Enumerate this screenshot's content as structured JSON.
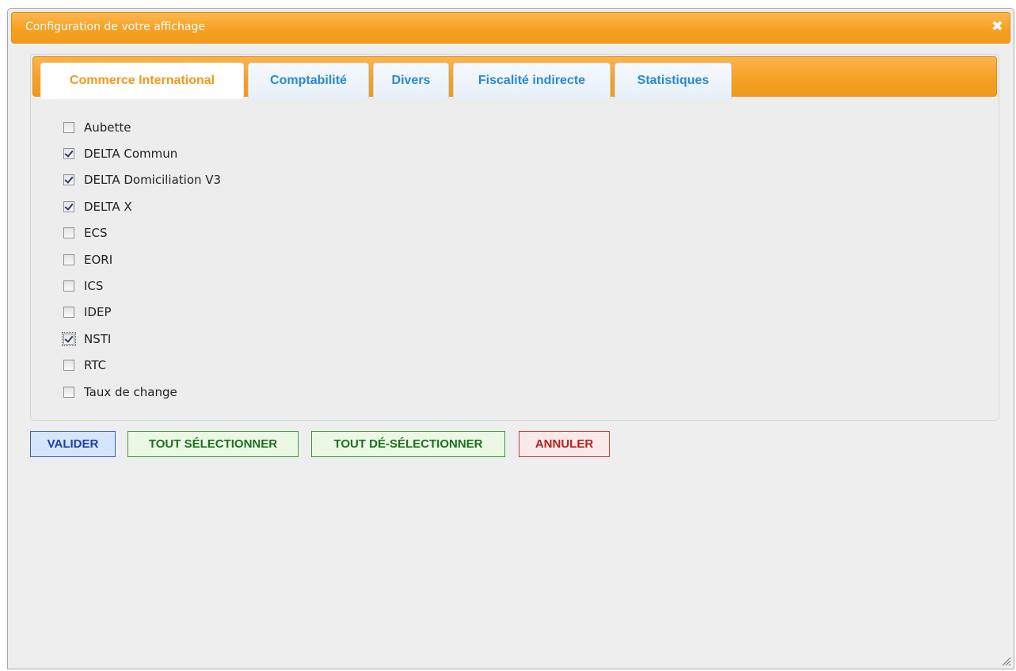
{
  "dialog": {
    "title": "Configuration de votre affichage",
    "close_glyph": "✖"
  },
  "tabs": [
    {
      "label": "Commerce International",
      "active": true
    },
    {
      "label": "Comptabilité",
      "active": false
    },
    {
      "label": "Divers",
      "active": false
    },
    {
      "label": "Fiscalité indirecte",
      "active": false
    },
    {
      "label": "Statistiques",
      "active": false
    }
  ],
  "items": [
    {
      "label": "Aubette",
      "checked": false
    },
    {
      "label": "DELTA Commun",
      "checked": true
    },
    {
      "label": "DELTA Domiciliation V3",
      "checked": true
    },
    {
      "label": "DELTA X",
      "checked": true
    },
    {
      "label": "ECS",
      "checked": false
    },
    {
      "label": "EORI",
      "checked": false
    },
    {
      "label": "ICS",
      "checked": false
    },
    {
      "label": "IDEP",
      "checked": false
    },
    {
      "label": "NSTI",
      "checked": true
    },
    {
      "label": "RTC",
      "checked": false
    },
    {
      "label": "Taux de change",
      "checked": false
    }
  ],
  "buttons": {
    "validate": "VALIDER",
    "select_all": "TOUT SÉLECTIONNER",
    "deselect_all": "TOUT DÉ-SÉLECTIONNER",
    "cancel": "ANNULER"
  },
  "colors": {
    "accent_orange": "#f7a021",
    "tab_text_blue": "#2a8ad0",
    "button_blue": "#1d3faa",
    "button_green": "#1f6f1f",
    "button_red": "#b21f1f"
  }
}
